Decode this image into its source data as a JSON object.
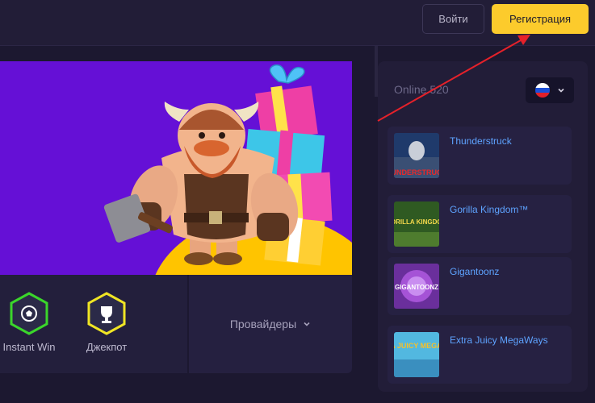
{
  "header": {
    "login_label": "Войти",
    "register_label": "Регистрация",
    "accent_color": "#fccb2c",
    "annotation_arrow_color": "#e5212a"
  },
  "categories": [
    {
      "label": "Instant Win",
      "icon": "soccer-ball-icon",
      "color": "#3bd62b"
    },
    {
      "label": "Джекпот",
      "icon": "trophy-icon",
      "color": "#f0e524"
    }
  ],
  "providers": {
    "label": "Провайдеры",
    "icon": "chevron-down-icon"
  },
  "sidebar": {
    "online_label": "Online 520",
    "language_flag": "russia-flag-icon",
    "games": [
      {
        "name": "Thunderstruck",
        "thumb_text": "UNDERSTRUC"
      },
      {
        "name": "Gorilla Kingdom™",
        "thumb_text": "GORILLA KINGDOM"
      },
      {
        "name": "Gigantoonz",
        "thumb_text": "GIGANTOONZ"
      },
      {
        "name": "Extra Juicy MegaWays",
        "thumb_text": "EXTRA JUICY MEGAWAYS"
      }
    ]
  }
}
